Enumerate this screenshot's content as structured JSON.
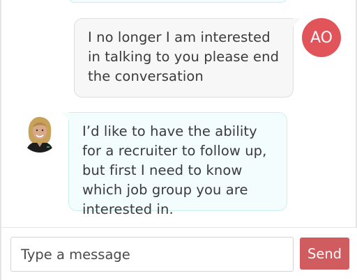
{
  "colors": {
    "accent": "#d05c60",
    "user_avatar_bg": "#e0545a",
    "bot_bubble_bg": "#f3fdfd",
    "user_bubble_bg": "#f7f7f7"
  },
  "messages": [
    {
      "sender": "user",
      "avatar_initials": "AO",
      "text": "I no longer I am interested in talking to you please end the conversation"
    },
    {
      "sender": "bot",
      "avatar_icon": "recruiter-avatar-photo",
      "text": "I’d like to have the ability for a recruiter to follow up, but first I need to know which job group you are interested in."
    }
  ],
  "composer": {
    "placeholder": "Type a message",
    "value": "",
    "send_label": "Send"
  }
}
